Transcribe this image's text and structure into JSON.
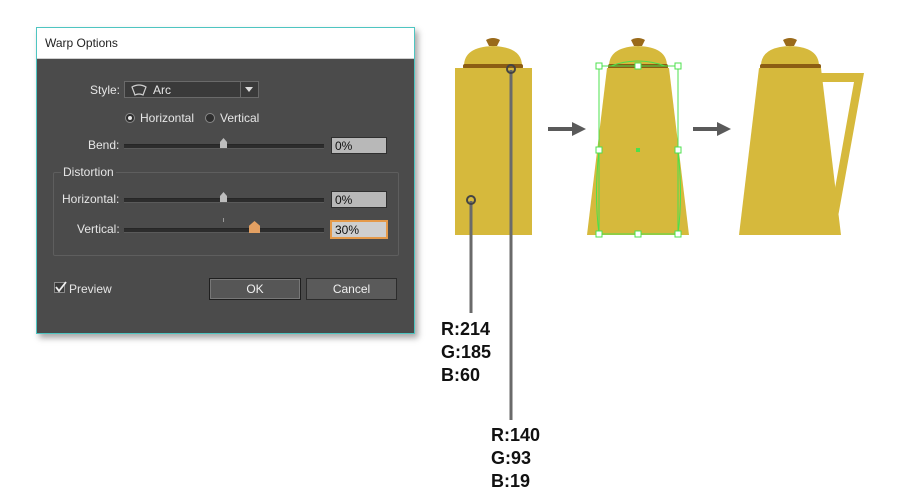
{
  "dialog": {
    "title": "Warp Options",
    "style_label": "Style:",
    "style_value": "Arc",
    "orientation": {
      "horizontal_label": "Horizontal",
      "vertical_label": "Vertical",
      "selected": "Horizontal"
    },
    "bend_label": "Bend:",
    "bend_value": "0%",
    "distortion_label": "Distortion",
    "dist_horizontal_label": "Horizontal:",
    "dist_horizontal_value": "0%",
    "dist_vertical_label": "Vertical:",
    "dist_vertical_value": "30%",
    "preview_label": "Preview",
    "preview_checked": true,
    "ok_label": "OK",
    "cancel_label": "Cancel"
  },
  "illustration": {
    "body_color": "#D6B93C",
    "lid_band_color": "#8C5D13",
    "selection_color": "#4CE04C",
    "swatch_body": {
      "r": "R:214",
      "g": "G:185",
      "b": "B:60"
    },
    "swatch_band": {
      "r": "R:140",
      "g": "G:93",
      "b": "B:19"
    }
  }
}
